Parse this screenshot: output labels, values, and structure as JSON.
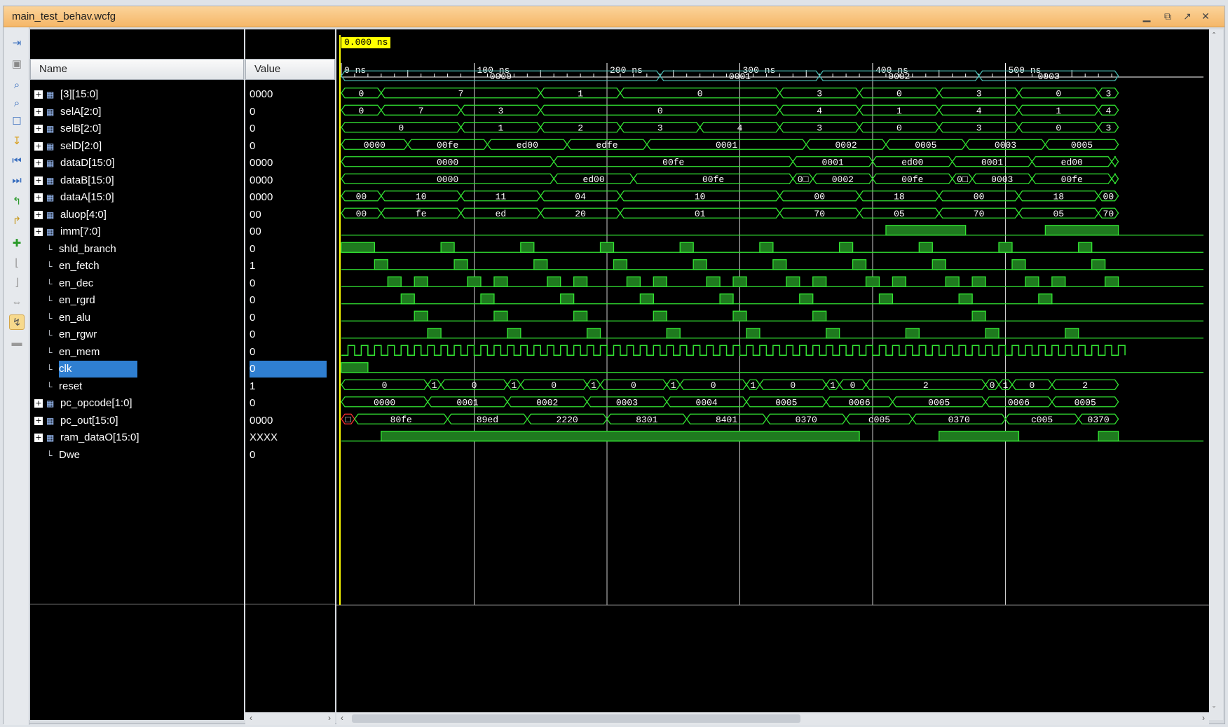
{
  "window": {
    "title": "main_test_behav.wcfg"
  },
  "columns": {
    "name": "Name",
    "value": "Value"
  },
  "cursor_time": "0.000 ns",
  "axis": {
    "ticks": [
      {
        "label": "0 ns",
        "t": 0
      },
      {
        "label": "100 ns",
        "t": 100
      },
      {
        "label": "200 ns",
        "t": 200
      },
      {
        "label": "300 ns",
        "t": 300
      },
      {
        "label": "400 ns",
        "t": 400
      },
      {
        "label": "500 ns",
        "t": 500
      }
    ],
    "max_t": 585
  },
  "colors": {
    "wave": "#33e533",
    "wave_fill": "#1f7a1f",
    "cursor": "#ffff00",
    "grid": "#ffffff",
    "selection": "#2f7fd1"
  },
  "signals": [
    {
      "name": "[3][15:0]",
      "value": "0000",
      "bus": true,
      "segs": [
        [
          0,
          240,
          "0000"
        ],
        [
          240,
          360,
          "0001"
        ],
        [
          360,
          480,
          "0002"
        ],
        [
          480,
          585,
          "0003"
        ]
      ],
      "seg_color": "#49b8b0"
    },
    {
      "name": "selA[2:0]",
      "value": "0",
      "bus": true,
      "segs": [
        [
          0,
          30,
          "0"
        ],
        [
          30,
          150,
          "7"
        ],
        [
          150,
          210,
          "1"
        ],
        [
          210,
          330,
          "0"
        ],
        [
          330,
          390,
          "3"
        ],
        [
          390,
          450,
          "0"
        ],
        [
          450,
          510,
          "3"
        ],
        [
          510,
          570,
          "0"
        ],
        [
          570,
          585,
          "3"
        ]
      ]
    },
    {
      "name": "selB[2:0]",
      "value": "0",
      "bus": true,
      "segs": [
        [
          0,
          30,
          "0"
        ],
        [
          30,
          90,
          "7"
        ],
        [
          90,
          150,
          "3"
        ],
        [
          150,
          330,
          "0"
        ],
        [
          330,
          390,
          "4"
        ],
        [
          390,
          450,
          "1"
        ],
        [
          450,
          510,
          "4"
        ],
        [
          510,
          570,
          "1"
        ],
        [
          570,
          585,
          "4"
        ]
      ]
    },
    {
      "name": "selD[2:0]",
      "value": "0",
      "bus": true,
      "segs": [
        [
          0,
          90,
          "0"
        ],
        [
          90,
          150,
          "1"
        ],
        [
          150,
          210,
          "2"
        ],
        [
          210,
          270,
          "3"
        ],
        [
          270,
          330,
          "4"
        ],
        [
          330,
          390,
          "3"
        ],
        [
          390,
          450,
          "0"
        ],
        [
          450,
          510,
          "3"
        ],
        [
          510,
          570,
          "0"
        ],
        [
          570,
          585,
          "3"
        ]
      ]
    },
    {
      "name": "dataD[15:0]",
      "value": "0000",
      "bus": true,
      "segs": [
        [
          0,
          50,
          "0000"
        ],
        [
          50,
          110,
          "00fe"
        ],
        [
          110,
          170,
          "ed00"
        ],
        [
          170,
          230,
          "edfe"
        ],
        [
          230,
          350,
          "0001"
        ],
        [
          350,
          410,
          "0002"
        ],
        [
          410,
          470,
          "0005"
        ],
        [
          470,
          530,
          "0003"
        ],
        [
          530,
          585,
          "0005"
        ]
      ]
    },
    {
      "name": "dataB[15:0]",
      "value": "0000",
      "bus": true,
      "segs": [
        [
          0,
          160,
          "0000"
        ],
        [
          160,
          340,
          "00fe"
        ],
        [
          340,
          400,
          "0001"
        ],
        [
          400,
          460,
          "ed00"
        ],
        [
          460,
          520,
          "0001"
        ],
        [
          520,
          580,
          "ed00"
        ],
        [
          580,
          585,
          ""
        ]
      ]
    },
    {
      "name": "dataA[15:0]",
      "value": "0000",
      "bus": true,
      "segs": [
        [
          0,
          160,
          "0000"
        ],
        [
          160,
          220,
          "ed00"
        ],
        [
          220,
          340,
          "00fe"
        ],
        [
          340,
          355,
          "0□"
        ],
        [
          355,
          400,
          "0002"
        ],
        [
          400,
          460,
          "00fe"
        ],
        [
          460,
          475,
          "0□"
        ],
        [
          475,
          520,
          "0003"
        ],
        [
          520,
          580,
          "00fe"
        ],
        [
          580,
          585,
          ""
        ]
      ]
    },
    {
      "name": "aluop[4:0]",
      "value": "00",
      "bus": true,
      "segs": [
        [
          0,
          30,
          "00"
        ],
        [
          30,
          90,
          "10"
        ],
        [
          90,
          150,
          "11"
        ],
        [
          150,
          210,
          "04"
        ],
        [
          210,
          330,
          "10"
        ],
        [
          330,
          390,
          "00"
        ],
        [
          390,
          450,
          "18"
        ],
        [
          450,
          510,
          "00"
        ],
        [
          510,
          570,
          "18"
        ],
        [
          570,
          585,
          "00"
        ]
      ]
    },
    {
      "name": "imm[7:0]",
      "value": "00",
      "bus": true,
      "segs": [
        [
          0,
          30,
          "00"
        ],
        [
          30,
          90,
          "fe"
        ],
        [
          90,
          150,
          "ed"
        ],
        [
          150,
          210,
          "20"
        ],
        [
          210,
          330,
          "01"
        ],
        [
          330,
          390,
          "70"
        ],
        [
          390,
          450,
          "05"
        ],
        [
          450,
          510,
          "70"
        ],
        [
          510,
          570,
          "05"
        ],
        [
          570,
          585,
          "70"
        ]
      ]
    },
    {
      "name": "shld_branch",
      "value": "0",
      "bus": false,
      "high": [
        [
          410,
          470
        ],
        [
          530,
          585
        ]
      ]
    },
    {
      "name": "en_fetch",
      "value": "1",
      "bus": false,
      "high": [
        [
          0,
          25
        ],
        [
          75,
          85
        ],
        [
          135,
          145
        ],
        [
          195,
          205
        ],
        [
          255,
          265
        ],
        [
          315,
          325
        ],
        [
          375,
          385
        ],
        [
          435,
          445
        ],
        [
          495,
          505
        ],
        [
          555,
          565
        ]
      ]
    },
    {
      "name": "en_dec",
      "value": "0",
      "bus": false,
      "high": [
        [
          25,
          35
        ],
        [
          85,
          95
        ],
        [
          145,
          155
        ],
        [
          205,
          215
        ],
        [
          265,
          275
        ],
        [
          325,
          335
        ],
        [
          385,
          395
        ],
        [
          445,
          455
        ],
        [
          505,
          515
        ],
        [
          565,
          575
        ]
      ]
    },
    {
      "name": "en_rgrd",
      "value": "0",
      "bus": false,
      "high": [
        [
          35,
          45
        ],
        [
          55,
          65
        ],
        [
          95,
          105
        ],
        [
          115,
          125
        ],
        [
          155,
          165
        ],
        [
          175,
          185
        ],
        [
          215,
          225
        ],
        [
          235,
          245
        ],
        [
          275,
          285
        ],
        [
          295,
          305
        ],
        [
          335,
          345
        ],
        [
          355,
          365
        ],
        [
          395,
          405
        ],
        [
          415,
          425
        ],
        [
          455,
          465
        ],
        [
          475,
          485
        ],
        [
          515,
          525
        ],
        [
          535,
          545
        ],
        [
          575,
          585
        ]
      ]
    },
    {
      "name": "en_alu",
      "value": "0",
      "bus": false,
      "high": [
        [
          45,
          55
        ],
        [
          105,
          115
        ],
        [
          165,
          175
        ],
        [
          225,
          235
        ],
        [
          285,
          295
        ],
        [
          345,
          355
        ],
        [
          405,
          415
        ],
        [
          465,
          475
        ],
        [
          525,
          535
        ]
      ]
    },
    {
      "name": "en_rgwr",
      "value": "0",
      "bus": false,
      "high": [
        [
          55,
          65
        ],
        [
          115,
          125
        ],
        [
          175,
          185
        ],
        [
          235,
          245
        ],
        [
          295,
          305
        ],
        [
          355,
          365
        ],
        [
          475,
          485
        ]
      ]
    },
    {
      "name": "en_mem",
      "value": "0",
      "bus": false,
      "high": [
        [
          65,
          75
        ],
        [
          125,
          135
        ],
        [
          185,
          195
        ],
        [
          245,
          255
        ],
        [
          305,
          315
        ],
        [
          365,
          375
        ],
        [
          425,
          435
        ],
        [
          485,
          495
        ],
        [
          545,
          555
        ]
      ]
    },
    {
      "name": "clk",
      "value": "0",
      "bus": false,
      "clock": 5,
      "selected": true
    },
    {
      "name": "reset",
      "value": "1",
      "bus": false,
      "high": [
        [
          0,
          20
        ]
      ]
    },
    {
      "name": "pc_opcode[1:0]",
      "value": "0",
      "bus": true,
      "segs": [
        [
          0,
          65,
          "0"
        ],
        [
          65,
          75,
          "1"
        ],
        [
          75,
          125,
          "0"
        ],
        [
          125,
          135,
          "1"
        ],
        [
          135,
          185,
          "0"
        ],
        [
          185,
          195,
          "1"
        ],
        [
          195,
          245,
          "0"
        ],
        [
          245,
          255,
          "1"
        ],
        [
          255,
          305,
          "0"
        ],
        [
          305,
          315,
          "1"
        ],
        [
          315,
          365,
          "0"
        ],
        [
          365,
          375,
          "1"
        ],
        [
          375,
          395,
          "0"
        ],
        [
          395,
          485,
          "2"
        ],
        [
          485,
          495,
          "0"
        ],
        [
          495,
          505,
          "1"
        ],
        [
          505,
          535,
          "0"
        ],
        [
          535,
          585,
          "2"
        ]
      ]
    },
    {
      "name": "pc_out[15:0]",
      "value": "0000",
      "bus": true,
      "segs": [
        [
          0,
          65,
          "0000"
        ],
        [
          65,
          125,
          "0001"
        ],
        [
          125,
          185,
          "0002"
        ],
        [
          185,
          245,
          "0003"
        ],
        [
          245,
          305,
          "0004"
        ],
        [
          305,
          365,
          "0005"
        ],
        [
          365,
          415,
          "0006"
        ],
        [
          415,
          485,
          "0005"
        ],
        [
          485,
          535,
          "0006"
        ],
        [
          535,
          585,
          "0005"
        ]
      ]
    },
    {
      "name": "ram_dataO[15:0]",
      "value": "XXXX",
      "bus": true,
      "segs": [
        [
          0,
          10,
          "□"
        ],
        [
          10,
          80,
          "80fe"
        ],
        [
          80,
          140,
          "89ed"
        ],
        [
          140,
          200,
          "2220"
        ],
        [
          200,
          260,
          "8301"
        ],
        [
          260,
          320,
          "8401"
        ],
        [
          320,
          380,
          "0370"
        ],
        [
          380,
          430,
          "c005"
        ],
        [
          430,
          500,
          "0370"
        ],
        [
          500,
          555,
          "c005"
        ],
        [
          555,
          585,
          "0370"
        ]
      ],
      "first_red": true
    },
    {
      "name": "Dwe",
      "value": "0",
      "bus": false,
      "high": [
        [
          30,
          390
        ],
        [
          450,
          510
        ],
        [
          570,
          585
        ]
      ]
    }
  ]
}
